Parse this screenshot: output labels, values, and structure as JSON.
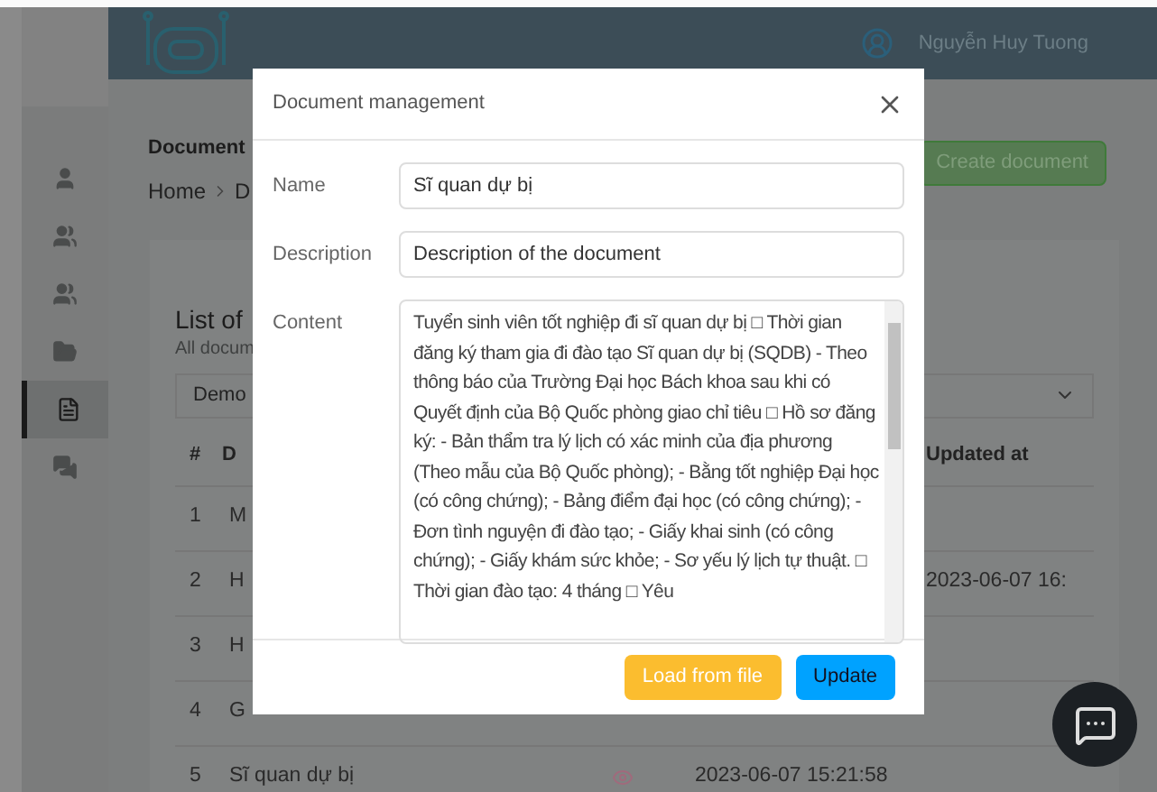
{
  "header": {
    "user_name": "Nguyễn Huy Tuong"
  },
  "sidebar": {
    "items": [
      {
        "kind": "user",
        "selected": false
      },
      {
        "kind": "users",
        "selected": false
      },
      {
        "kind": "users",
        "selected": false
      },
      {
        "kind": "folder",
        "selected": false
      },
      {
        "kind": "file",
        "selected": true
      },
      {
        "kind": "comments",
        "selected": false
      }
    ]
  },
  "page": {
    "title": "Document",
    "breadcrumb": [
      "Home",
      "D"
    ],
    "create_button": "Create document"
  },
  "card": {
    "title": "List of",
    "subtitle": "All docum",
    "select": "Demo",
    "columns": [
      "#",
      "D",
      "Updated at"
    ],
    "rows": [
      {
        "index": "1",
        "document": "M",
        "view_icon": false
      },
      {
        "index": "2",
        "document": "H",
        "view_icon": false,
        "updated_at": "2023-06-07 16:"
      },
      {
        "index": "3",
        "document": "H",
        "view_icon": false
      },
      {
        "index": "4",
        "document": "G",
        "view_icon": false
      },
      {
        "index": "5",
        "document": "Sĩ quan dự bị",
        "view_icon": true,
        "created_at": "2023-06-07 15:21:58"
      }
    ]
  },
  "modal": {
    "title": "Document management",
    "fields": [
      {
        "label": "Name",
        "kind": "input",
        "value": "Sĩ quan dự bị"
      },
      {
        "label": "Description",
        "kind": "input",
        "value": "Description of the document"
      },
      {
        "label": "Content",
        "kind": "textarea",
        "value": "Tuyển sinh viên tốt nghiệp đi sĩ quan dự bị □ Thời gian đăng ký tham gia đi đào tạo Sĩ quan dự bị (SQDB) - Theo thông báo của Trường Đại học Bách khoa sau khi có Quyết định của Bộ Quốc phòng giao chỉ tiêu □ Hồ sơ đăng ký: - Bản thẩm tra lý lịch có xác minh của địa phương (Theo mẫu của Bộ Quốc phòng); - Bằng tốt nghiệp Đại học (có công chứng); - Bảng điểm đại học (có công chứng); - Đơn tình nguyện đi đào tạo; - Giấy khai sinh (có công chứng); - Giấy khám sức khỏe; - Sơ yếu lý lịch tự thuật. □ Thời gian đào tạo: 4 tháng □ Yêu"
      }
    ],
    "buttons": [
      {
        "label": "Load from file",
        "kind": "warning"
      },
      {
        "label": "Update",
        "kind": "primary"
      }
    ]
  }
}
